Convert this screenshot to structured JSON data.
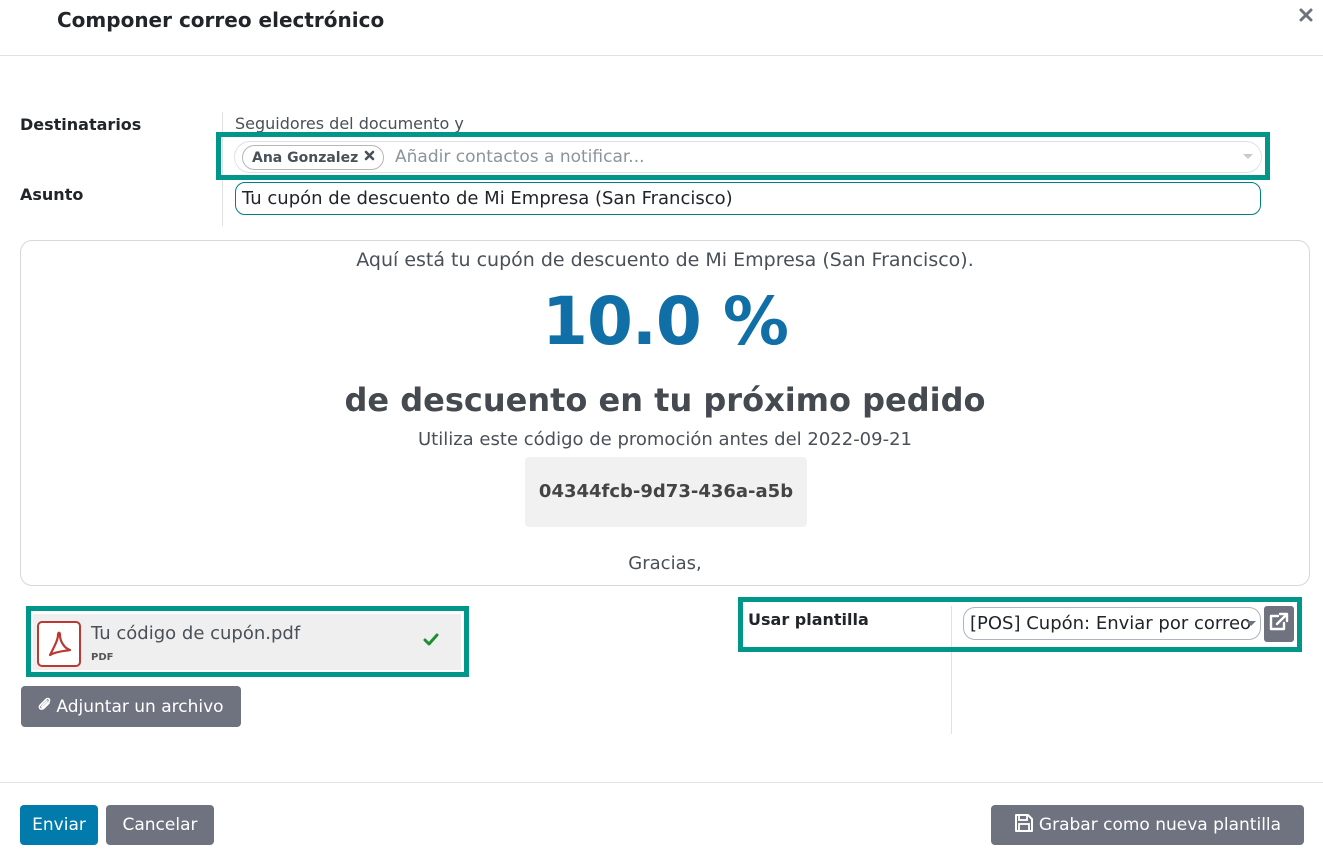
{
  "dialog": {
    "title": "Componer correo electrónico"
  },
  "form": {
    "recipients_label": "Destinatarios",
    "followers_text": "Seguidores del documento y",
    "recipient_tags": [
      "Ana Gonzalez"
    ],
    "recipients_placeholder": "Añadir contactos a notificar...",
    "subject_label": "Asunto",
    "subject_value": "Tu cupón de descuento de Mi Empresa (San Francisco)"
  },
  "email_body": {
    "intro": "Aquí está tu cupón de descuento de Mi Empresa (San Francisco).",
    "discount": "10.0 %",
    "discount_text": "de descuento en tu próximo pedido",
    "valid_text": "Utiliza este código de promoción antes del 2022-09-21",
    "code": "04344fcb-9d73-436a-a5b",
    "thanks": "Gracias,"
  },
  "attachment": {
    "name": "Tu código de cupón.pdf",
    "ext": "PDF"
  },
  "attach_button": "Adjuntar un archivo",
  "template": {
    "label": "Usar plantilla",
    "selected": "[POS] Cupón: Enviar por correo"
  },
  "footer": {
    "send": "Enviar",
    "cancel": "Cancelar",
    "save_template": "Grabar como nueva plantilla"
  },
  "colors": {
    "highlight": "#00968a",
    "primary": "#017aac",
    "discount": "#0f6fa6",
    "secondary_button": "#6f7380"
  },
  "icons": {
    "close": "close-icon",
    "tag_remove": "x-icon",
    "pdf": "pdf-icon",
    "check": "check-icon",
    "paperclip": "paperclip-icon",
    "external_link": "external-link-icon",
    "save": "floppy-disk-icon"
  }
}
